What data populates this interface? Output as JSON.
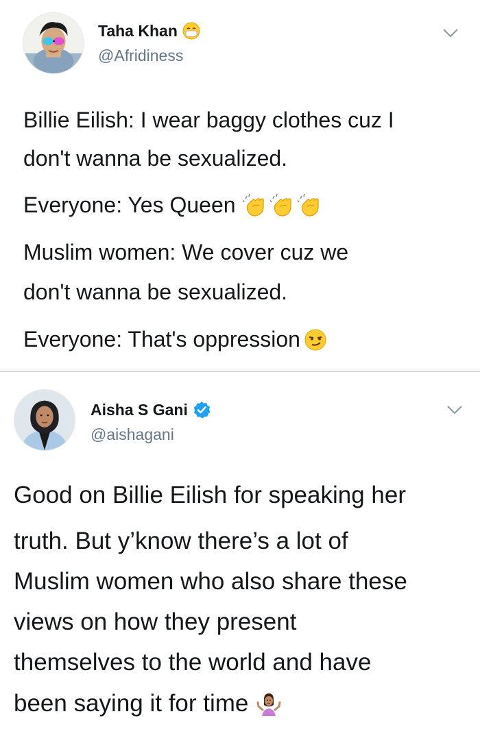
{
  "tweets": [
    {
      "display_name": "Taha Khan",
      "name_icon": "mask-face-emoji-icon",
      "handle": "@Afridiness",
      "lines": [
        "Billie Eilish:  I wear baggy clothes cuz I",
        "don't wanna be sexualized.",
        "Everyone:  Yes Queen",
        "Muslim women:  We cover cuz we",
        "don't wanna be sexualized.",
        "Everyone:  That's oppression"
      ],
      "line_emojis": {
        "2": [
          "clapping-hands-icon",
          "clapping-hands-icon",
          "clapping-hands-icon"
        ],
        "5": [
          "smirking-face-icon"
        ]
      }
    },
    {
      "display_name": "Aisha S Gani",
      "name_icon": "verified-badge-icon",
      "handle": "@aishagani",
      "lines": [
        "Good on Billie Eilish for speaking her",
        "truth. But y’know there’s a lot of",
        "Muslim women who also share these",
        "views on how they present",
        "themselves to the world and have",
        "been saying it for time"
      ],
      "line_emojis": {
        "5": [
          "person-shrugging-icon"
        ]
      }
    }
  ],
  "colors": {
    "text": "#14171a",
    "secondary_text": "#657786",
    "verified_blue": "#1da1f2",
    "separator": "#d9d9d9",
    "emoji_yellow": "#ffcc33"
  }
}
